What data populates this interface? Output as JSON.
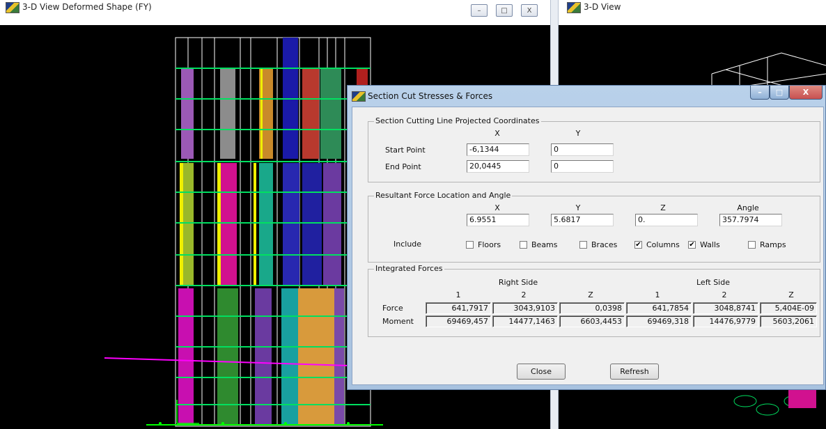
{
  "left_window": {
    "title": "3-D View  Deformed Shape (FY)",
    "buttons": {
      "minimize": "–",
      "maximize": "□",
      "close": "X"
    }
  },
  "right_window": {
    "title": "3-D View"
  },
  "dialog": {
    "title": "Section Cut Stresses & Forces",
    "cutting_line": {
      "group_label": "Section Cutting Line Projected Coordinates",
      "col_x": "X",
      "col_y": "Y",
      "start_label": "Start Point",
      "start_x": "-6,1344",
      "start_y": "0",
      "end_label": "End Point",
      "end_x": "20,0445",
      "end_y": "0"
    },
    "resultant": {
      "group_label": "Resultant Force Location and Angle",
      "col_x": "X",
      "col_y": "Y",
      "col_z": "Z",
      "col_angle": "Angle",
      "x": "6.9551",
      "y": "5.6817",
      "z": "0.",
      "angle": "357.7974",
      "include_label": "Include",
      "options": [
        {
          "label": "Floors",
          "checked": false
        },
        {
          "label": "Beams",
          "checked": false
        },
        {
          "label": "Braces",
          "checked": false
        },
        {
          "label": "Columns",
          "checked": true
        },
        {
          "label": "Walls",
          "checked": true
        },
        {
          "label": "Ramps",
          "checked": false
        }
      ],
      "check_mark": "✔"
    },
    "integrated": {
      "group_label": "Integrated Forces",
      "right_side": "Right Side",
      "left_side": "Left Side",
      "col_headers": [
        "1",
        "2",
        "Z",
        "1",
        "2",
        "Z"
      ],
      "rows": [
        {
          "label": "Force",
          "values": [
            "641,7917",
            "3043,9103",
            "0,0398",
            "641,7854",
            "3048,8741",
            "5,404E-09"
          ]
        },
        {
          "label": "Moment",
          "values": [
            "69469,457",
            "14477,1463",
            "6603,4453",
            "69469,318",
            "14476,9779",
            "5603,2061"
          ]
        }
      ]
    },
    "close_button": "Close",
    "refresh_button": "Refresh",
    "title_buttons": {
      "minimize": "–",
      "maximize": "□",
      "close": "X"
    }
  },
  "colors": {
    "viewport_bg": "#000000",
    "grid_line": "#00e060",
    "frame_line": "#ffffff",
    "dialog_frame": "#b9d1ea",
    "close_red": "#c75050"
  }
}
